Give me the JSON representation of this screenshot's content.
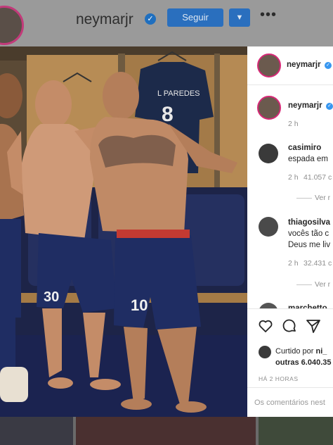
{
  "header": {
    "username": "neymarjr",
    "follow_label": "Seguir",
    "more_glyph": "•••"
  },
  "photo": {
    "jersey_name": "L PAREDES",
    "jersey_number": "8",
    "shorts_numbers": [
      "30",
      "10"
    ]
  },
  "post": {
    "author": "neymarjr",
    "caption_author": "neymarjr",
    "caption_time": "2 h",
    "comments": [
      {
        "user": "casimiro",
        "text": "espada em",
        "time": "2 h",
        "likes": "41.057 c",
        "replies": "Ver r"
      },
      {
        "user": "thiagosilva",
        "text_lines": [
          "vocês tão c",
          "Deus me liv"
        ],
        "time": "2 h",
        "likes": "32.431 c",
        "replies": "Ver r"
      },
      {
        "user": "marchetto"
      }
    ],
    "liked_by_prefix": "Curtido por",
    "liked_by_user": "ni_",
    "liked_by_others": "outras 6.040.35",
    "time_ago": "HÁ 2 HORAS",
    "comment_placeholder": "Os comentários nest"
  },
  "colors": {
    "verified": "#3897f0",
    "follow_button": "#2a6fbe",
    "story_ring": "#d62976"
  }
}
